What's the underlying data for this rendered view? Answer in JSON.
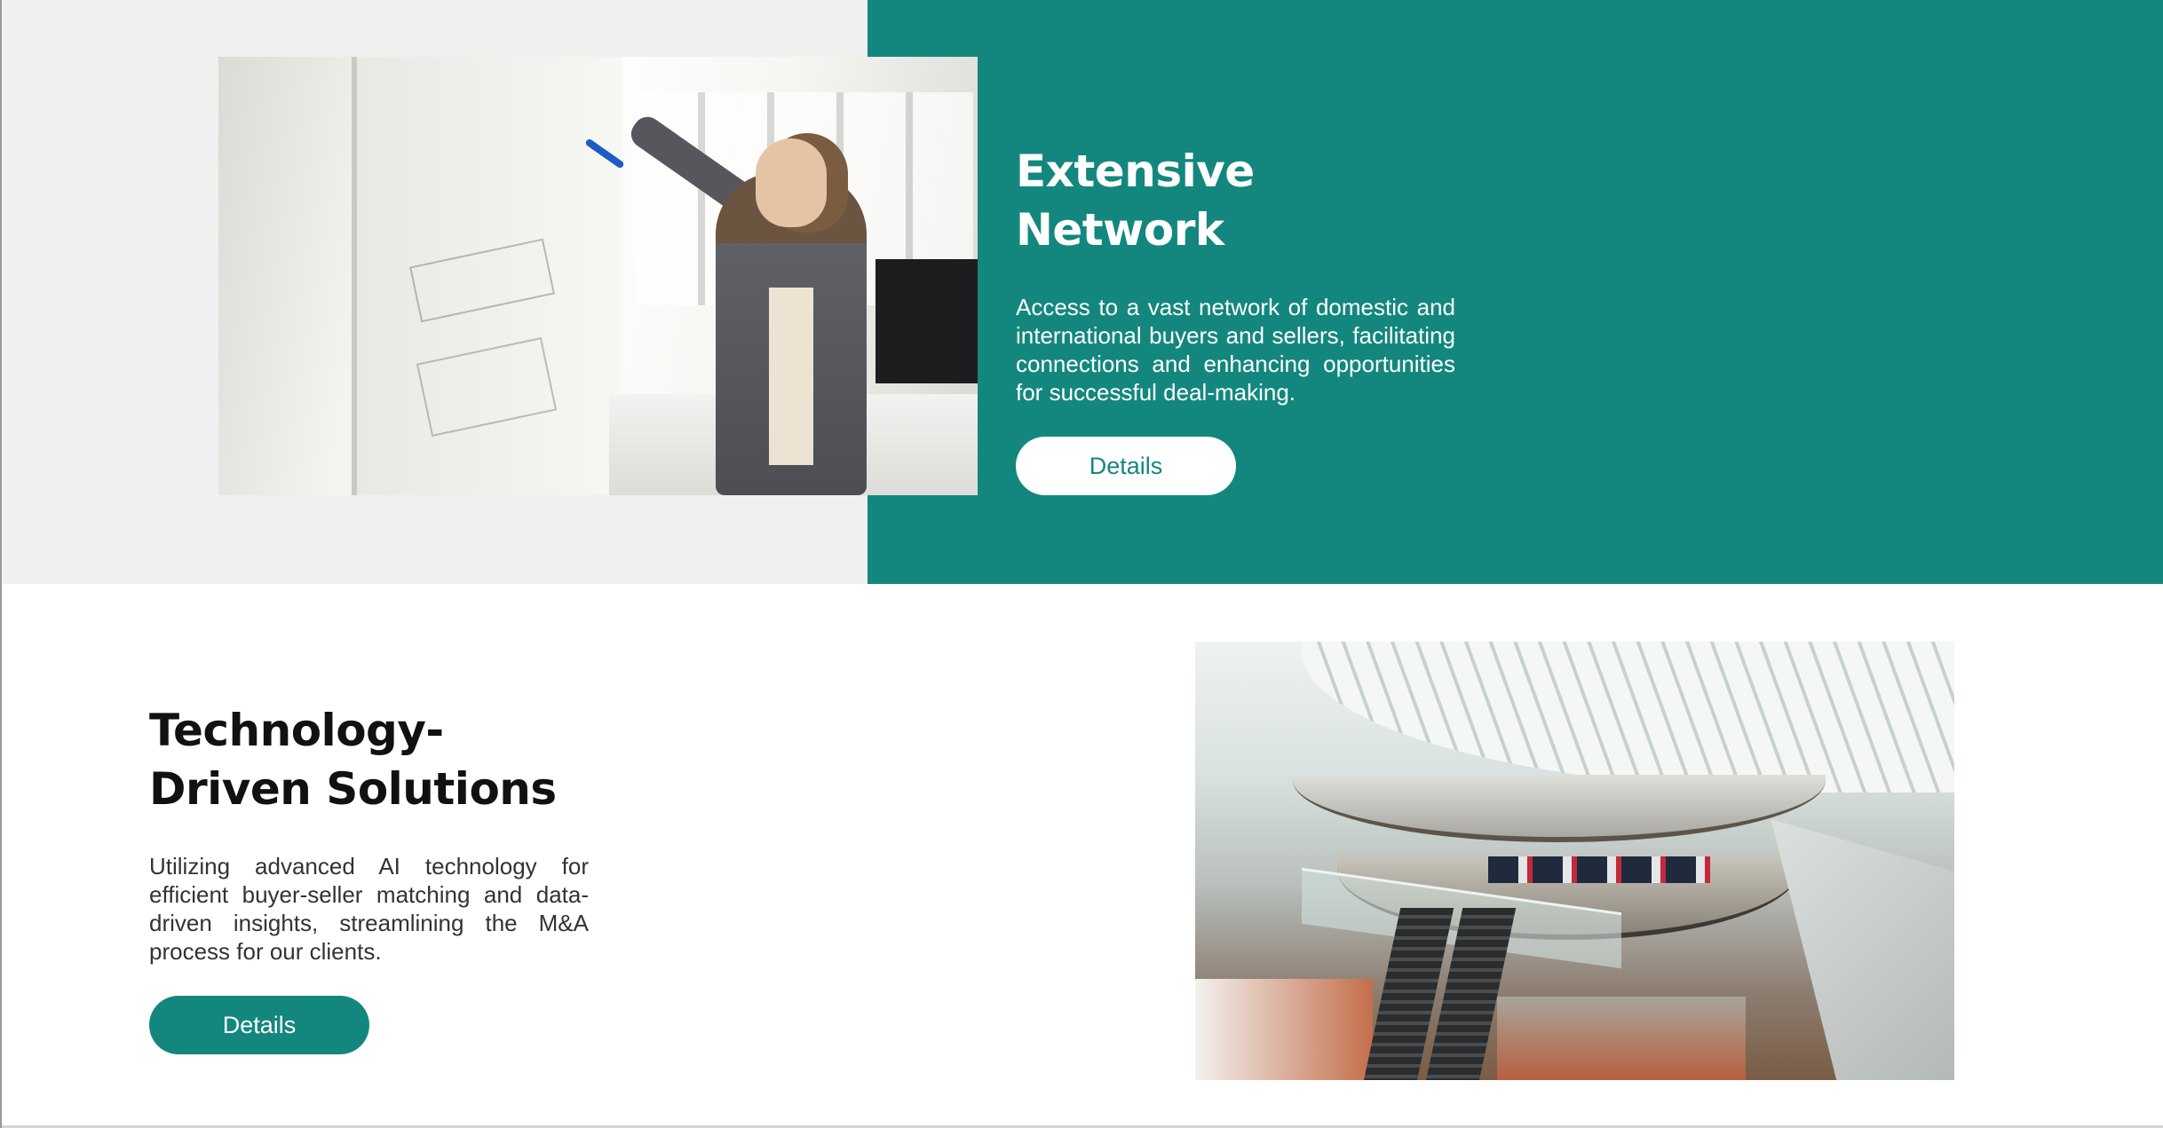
{
  "colors": {
    "accent": "#13877e",
    "section1_left_bg": "#f0f0f0",
    "section2_bg": "#ffffff",
    "button_text_light": "#13877e",
    "button_text_dark": "#ffffff"
  },
  "feature_network": {
    "title": "Extensive Network",
    "description": "Access to a vast network of domestic and international buyers and sellers, facilitating connections and enhancing opportunities for successful deal-making.",
    "button_label": "Details",
    "image_alt": "Woman writing on a glass whiteboard in an office"
  },
  "feature_technology": {
    "title": "Technology-Driven Solutions",
    "description": "Utilizing advanced AI technology for efficient buyer-seller matching and data-driven insights, streamlining the M&A process for our clients.",
    "button_label": "Details",
    "image_alt": "Multi-level shopping mall interior with escalators and glass roof"
  }
}
